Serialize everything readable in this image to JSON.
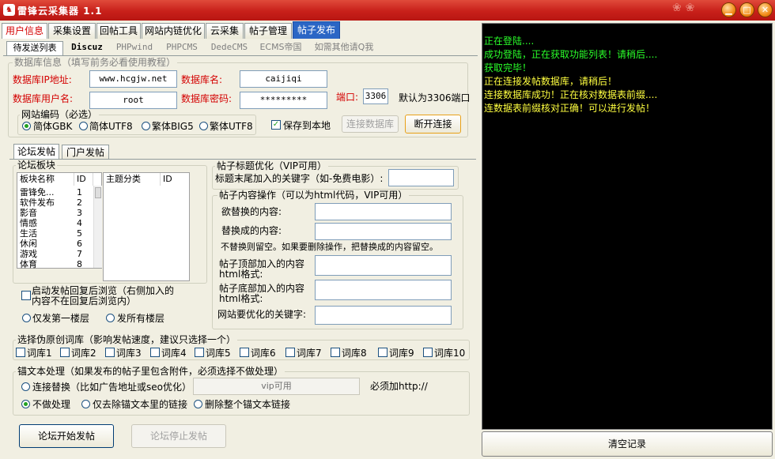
{
  "window": {
    "title": "雷锋云采集器 1.1",
    "logo_glyph": "♞",
    "min": "▁",
    "max": "□",
    "close": "✕"
  },
  "main_tabs": [
    "用户信息",
    "采集设置",
    "回帖工具",
    "网站内链优化",
    "云采集",
    "帖子管理",
    "帖子发布"
  ],
  "sub_tabs": [
    "待发送列表",
    "Discuz",
    "PHPwind",
    "PHPCMS",
    "DedeCMS",
    "ECMS帝国",
    "如需其他请Q我"
  ],
  "db": {
    "group_label": "数据库信息（填写前务必看使用教程）",
    "ip_label": "数据库IP地址:",
    "ip_value": "www.hcgjw.net",
    "name_label": "数据库名:",
    "name_value": "caijiqi",
    "user_label": "数据库用户名:",
    "user_value": "root",
    "pwd_label": "数据库密码:",
    "pwd_value": "*********",
    "port_label": "端口:",
    "port_value": "3306",
    "port_hint": "默认为3306端口",
    "encoding_label": "网站编码（必选）",
    "encodings": [
      "简体GBK",
      "简体UTF8",
      "繁体BIG5",
      "繁体UTF8"
    ],
    "save_local": "保存到本地",
    "connect_btn": "连接数据库",
    "disconnect_btn": "断开连接"
  },
  "post_tabs": [
    "论坛发帖",
    "门户发帖"
  ],
  "forum": {
    "group_label": "论坛板块",
    "col1": "板块名称",
    "col2": "ID",
    "col3": "主题分类",
    "col4": "ID",
    "rows": [
      [
        "雷锋免...",
        "1"
      ],
      [
        "软件发布",
        "2"
      ],
      [
        "影音",
        "3"
      ],
      [
        "情感",
        "4"
      ],
      [
        "生活",
        "5"
      ],
      [
        "休闲",
        "6"
      ],
      [
        "游戏",
        "7"
      ],
      [
        "体育",
        "8"
      ]
    ],
    "auto_reply": "启动发帖回复后浏览（右侧加入的内容不在回复后浏览内）",
    "first_floor": "仅发第一楼层",
    "all_floors": "发所有楼层"
  },
  "title_opt": {
    "group_label": "帖子标题优化（VIP可用）",
    "suffix_label": "标题末尾加入的关键字（如-免费电影）:"
  },
  "content_op": {
    "group_label": "帖子内容操作（可以为html代码，VIP可用）",
    "replace_from": "欲替换的内容:",
    "replace_to": "替换成的内容:",
    "note": "不替换则留空。如果要删除操作，把替换成的内容留空。",
    "top_label": "帖子顶部加入的内容html格式:",
    "bottom_label": "帖子底部加入的内容html格式:",
    "keywords_label": "网站要优化的关键字:"
  },
  "lib": {
    "group_label": "选择伪原创词库（影响发帖速度，建议只选择一个）",
    "items": [
      "词库1",
      "词库2",
      "词库3",
      "词库4",
      "词库5",
      "词库6",
      "词库7",
      "词库8",
      "词库9",
      "词库10"
    ]
  },
  "anchor": {
    "group_label": "锚文本处理（如果发布的帖子里包含附件，必须选择不做处理）",
    "replace_link": "连接替换（比如广告地址或seo优化）",
    "vip_field": "vip可用",
    "http_hint": "必须加http://",
    "no_process": "不做处理",
    "remove_anchor_only": "仅去除锚文本里的链接",
    "remove_whole_link": "删除整个锚文本链接"
  },
  "actions": {
    "start": "论坛开始发帖",
    "stop": "论坛停止发帖"
  },
  "console": {
    "lines": [
      {
        "text": "正在登陆....",
        "color": "green"
      },
      {
        "text": "成功登陆，正在获取功能列表！请稍后....",
        "color": "green"
      },
      {
        "text": "获取完毕！",
        "color": "green"
      },
      {
        "text": "正在连接发帖数据库，请稍后！",
        "color": "yellow"
      },
      {
        "text": "连接数据库成功！正在核对数据表前缀....",
        "color": "yellow"
      },
      {
        "text": "连数据表前缀核对正确！可以进行发帖！",
        "color": "yellow"
      }
    ],
    "clear_btn": "清空记录"
  }
}
